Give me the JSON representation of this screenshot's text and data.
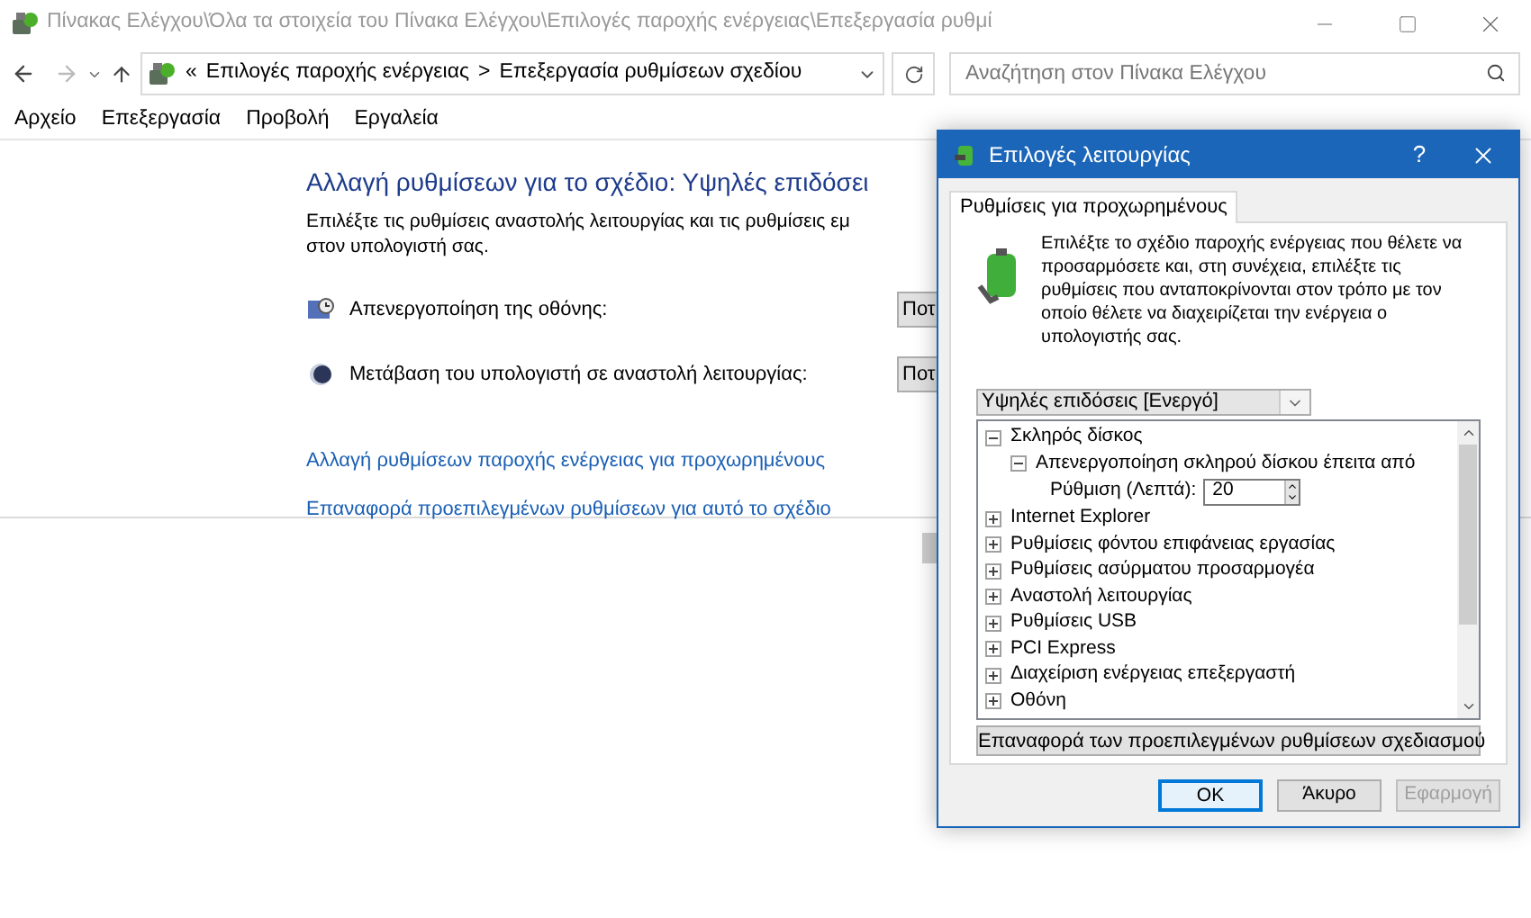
{
  "window": {
    "title": "Πίνακας Ελέγχου\\Όλα τα στοιχεία του Πίνακα Ελέγχου\\Επιλογές παροχής ενέργειας\\Επεξεργασία ρυθμί"
  },
  "nav": {
    "prefix": "«",
    "crumbs": [
      "Επιλογές παροχής ενέργειας",
      "Επεξεργασία ρυθμίσεων σχεδίου"
    ],
    "separator": ">",
    "search": {
      "placeholder": "Αναζήτηση στον Πίνακα Ελέγχου"
    }
  },
  "menu": [
    "Αρχείο",
    "Επεξεργασία",
    "Προβολή",
    "Εργαλεία"
  ],
  "content": {
    "heading": "Αλλαγή ρυθμίσεων για το σχέδιο: Υψηλές επιδόσει",
    "description_lines": [
      "Επιλέξτε τις ρυθμίσεις αναστολής λειτουργίας και τις ρυθμίσεις εμ",
      "στον υπολογιστή σας."
    ],
    "settings": [
      {
        "kind": "display",
        "label": "Απενεργοποίηση της οθόνης:",
        "value": "Ποτ"
      },
      {
        "kind": "sleep",
        "label": "Μετάβαση του υπολογιστή σε αναστολή λειτουργίας:",
        "value": "Ποτ"
      }
    ],
    "links": [
      "Αλλαγή ρυθμίσεων παροχής ενέργειας για προχωρημένους",
      "Επαναφορά προεπιλεγμένων ρυθμίσεων για αυτό το σχέδιο"
    ]
  },
  "dialog": {
    "title": "Επιλογές λειτουργίας",
    "help": "?",
    "tabs": [
      {
        "label": "Ρυθμίσεις για προχωρημένους",
        "selected": true
      }
    ],
    "intro": "Επιλέξτε το σχέδιο παροχής ενέργειας που θέλετε να προσαρμόσετε και, στη συνέχεια, επιλέξτε τις ρυθμίσεις που ανταποκρίνονται στον τρόπο με τον οποίο θέλετε να διαχειρίζεται την ενέργεια ο υπολογιστής σας.",
    "plan": "Υψηλές επιδόσεις [Ενεργό]",
    "tree": [
      {
        "label": "Σκληρός δίσκος",
        "expanded": true,
        "children": [
          {
            "label": "Απενεργοποίηση σκληρού δίσκου έπειτα από",
            "expanded": true,
            "children": [
              {
                "kind": "spinner",
                "label": "Ρύθμιση (Λεπτά):",
                "value": "20"
              }
            ]
          }
        ]
      },
      {
        "label": "Internet Explorer",
        "expanded": false
      },
      {
        "label": "Ρυθμίσεις φόντου επιφάνειας εργασίας",
        "expanded": false
      },
      {
        "label": "Ρυθμίσεις ασύρματου προσαρμογέα",
        "expanded": false
      },
      {
        "label": "Αναστολή λειτουργίας",
        "expanded": false
      },
      {
        "label": "Ρυθμίσεις USB",
        "expanded": false
      },
      {
        "label": "PCI Express",
        "expanded": false
      },
      {
        "label": "Διαχείριση ενέργειας επεξεργαστή",
        "expanded": false
      },
      {
        "label": "Οθόνη",
        "expanded": false
      }
    ],
    "restore_button": "Επαναφορά των προεπιλεγμένων ρυθμίσεων σχεδιασμού",
    "buttons": [
      {
        "label": "OK",
        "default": true,
        "disabled": false
      },
      {
        "label": "Άκυρο",
        "default": false,
        "disabled": false
      },
      {
        "label": "Εφαρμογή",
        "default": false,
        "disabled": true
      }
    ]
  }
}
